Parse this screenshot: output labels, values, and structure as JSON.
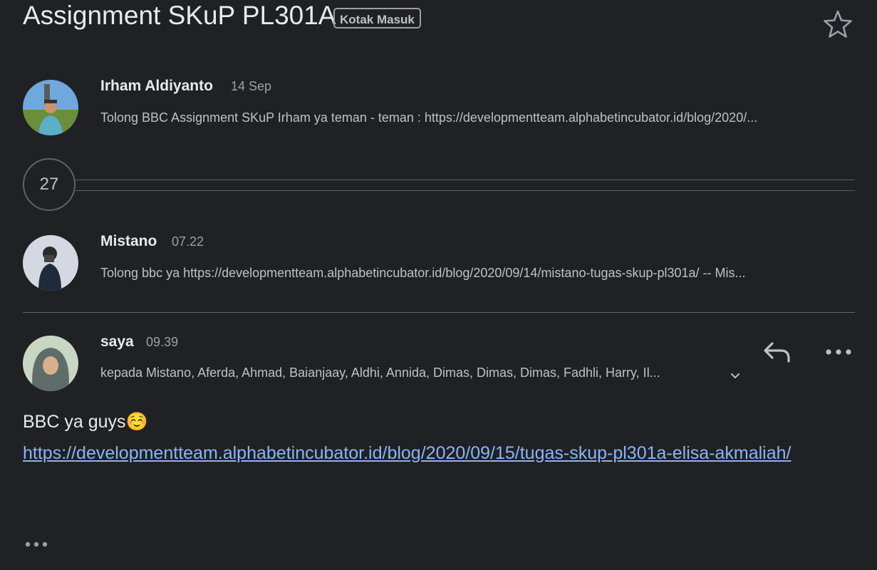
{
  "thread": {
    "subject": "Assignment SKuP PL301A",
    "label": "Kotak Masuk",
    "star_icon": "star-outline-icon"
  },
  "messages": [
    {
      "sender": "Irham Aldiyanto",
      "time": "14 Sep",
      "snippet": "Tolong BBC Assignment SKuP Irham ya teman - teman : https://developmentteam.alphabetincubator.id/blog/2020/..."
    },
    {
      "sender": "Mistano",
      "time": "07.22",
      "snippet": "Tolong bbc ya https://developmentteam.alphabetincubator.id/blog/2020/09/14/mistano-tugas-skup-pl301a/ -- Mis..."
    }
  ],
  "collapsed": {
    "count": "27"
  },
  "open_message": {
    "sender": "saya",
    "time": "09.39",
    "recipients": "kepada Mistano, Aferda, Ahmad, Baianjaay, Aldhi, Annida, Dimas, Dimas, Dimas, Fadhli, Harry, Il...",
    "body": "BBC ya guys☺️",
    "link": "https://developmentteam.alphabetincubator.id/blog/2020/09/15/tugas-skup-pl301a-elisa-akmaliah/",
    "reply_icon": "reply-icon",
    "more_icon": "more-horizontal-icon",
    "trimmed_icon": "show-trimmed-content-icon"
  },
  "colors": {
    "background": "#202124",
    "link": "#8ab4f8",
    "secondary_text": "#9aa0a6"
  }
}
